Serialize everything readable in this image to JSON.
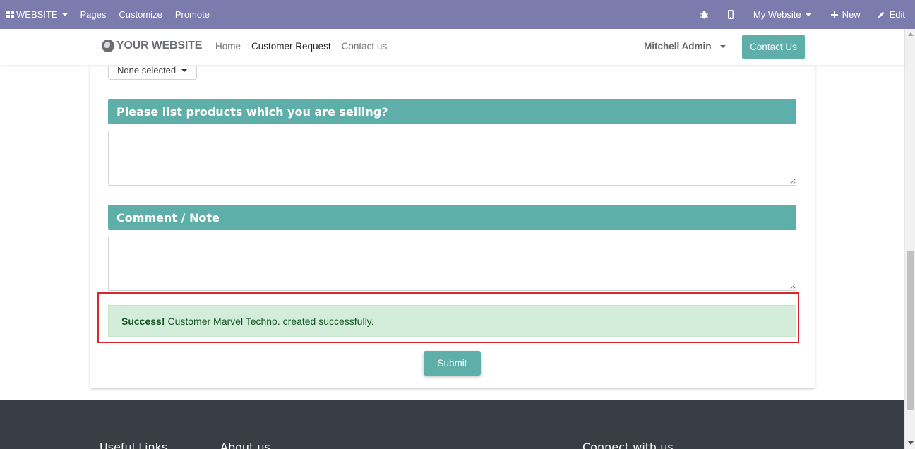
{
  "admin_bar": {
    "website_label": "WEBSITE",
    "pages_label": "Pages",
    "customize_label": "Customize",
    "promote_label": "Promote",
    "my_website_label": "My Website",
    "new_label": "New",
    "edit_label": "Edit"
  },
  "navbar": {
    "logo_text": "YOUR WEBSITE",
    "links": [
      "Home",
      "Customer Request",
      "Contact us"
    ],
    "user_name": "Mitchell Admin",
    "cta_label": "Contact Us"
  },
  "form": {
    "select_value": "None selected",
    "products_header": "Please list products which you are selling?",
    "comment_header": "Comment / Note",
    "success_strong": "Success!",
    "success_message": "Customer Marvel Techno. created successfully.",
    "submit_label": "Submit"
  },
  "footer": {
    "useful_links": "Useful Links",
    "about_us": "About us",
    "connect": "Connect with us"
  },
  "colors": {
    "admin_bar": "#7c7bad",
    "accent": "#5eaea9",
    "success_bg": "#d4edda",
    "success_text": "#155724",
    "highlight_frame": "#d9262b",
    "footer_bg": "#383e45"
  }
}
